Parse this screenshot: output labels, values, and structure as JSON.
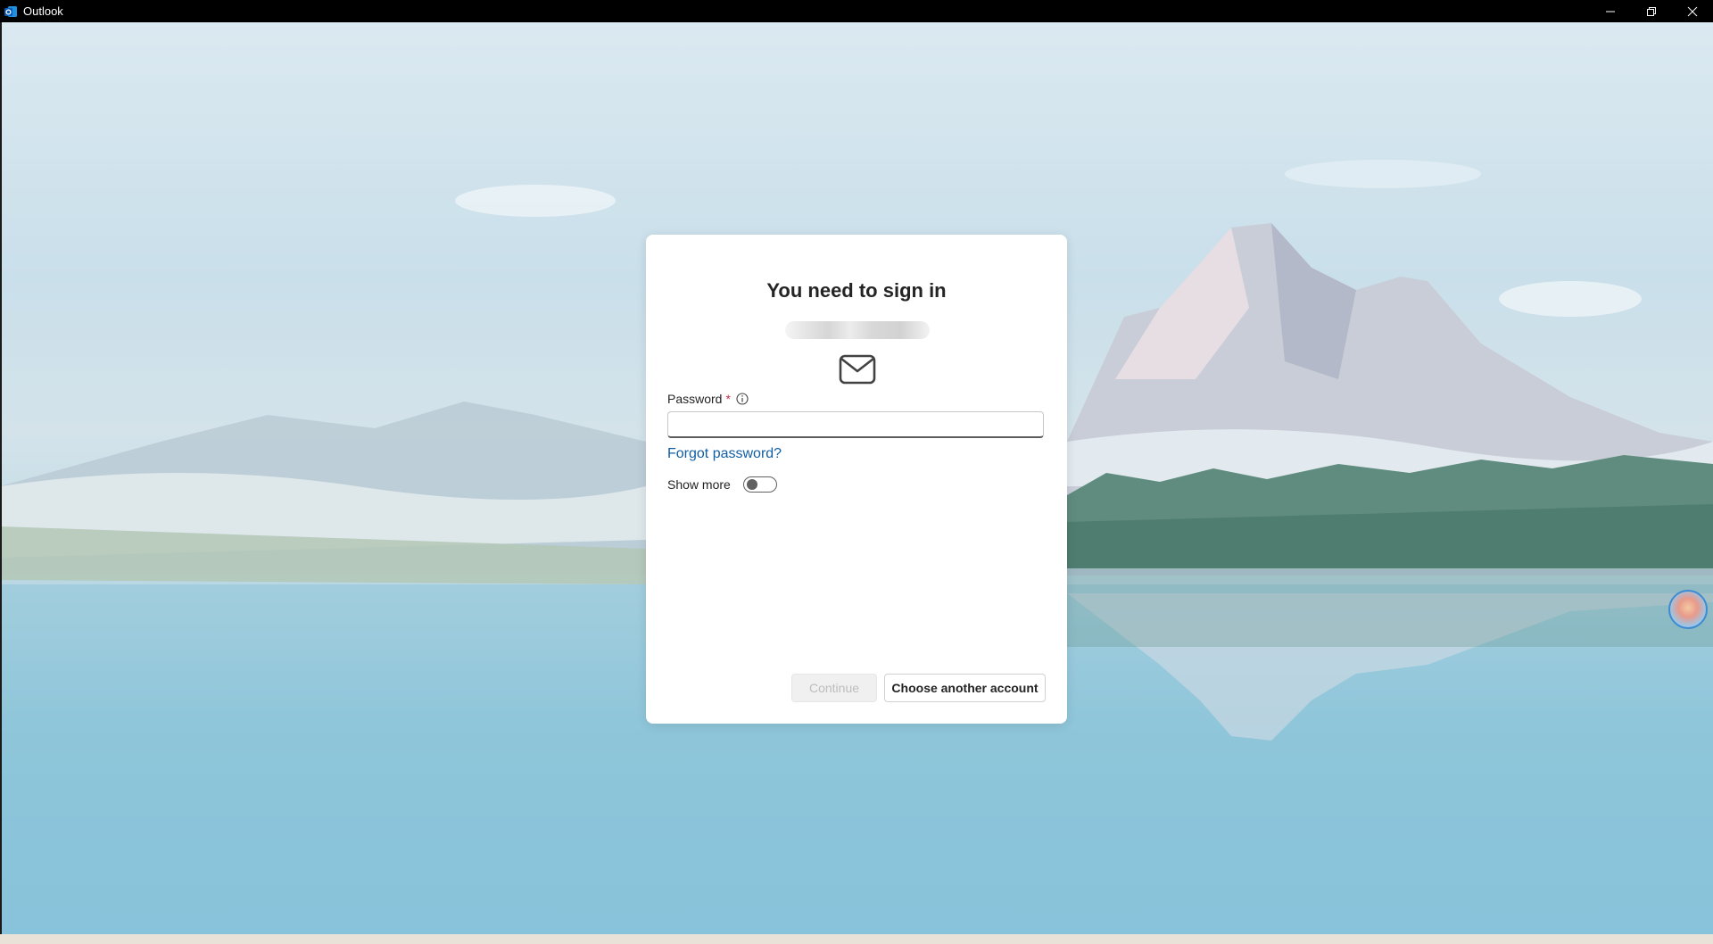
{
  "window": {
    "title": "Outlook",
    "app_icon": "outlook-icon",
    "controls": {
      "minimize_icon": "minimize-icon",
      "restore_icon": "restore-icon",
      "close_icon": "close-icon"
    }
  },
  "dialog": {
    "title": "You need to sign in",
    "email_redacted": true,
    "mail_icon": "mail-icon",
    "password": {
      "label": "Password",
      "required_marker": "*",
      "info_icon": "info-icon",
      "value": "",
      "placeholder": ""
    },
    "forgot_password_link": "Forgot password?",
    "show_more": {
      "label": "Show more",
      "enabled": false
    },
    "buttons": {
      "continue": "Continue",
      "choose_another_account": "Choose another account"
    }
  },
  "colors": {
    "titlebar": "#000000",
    "link": "#115ea3",
    "required": "#c4314b",
    "disabled_text": "#bdbdbd"
  }
}
